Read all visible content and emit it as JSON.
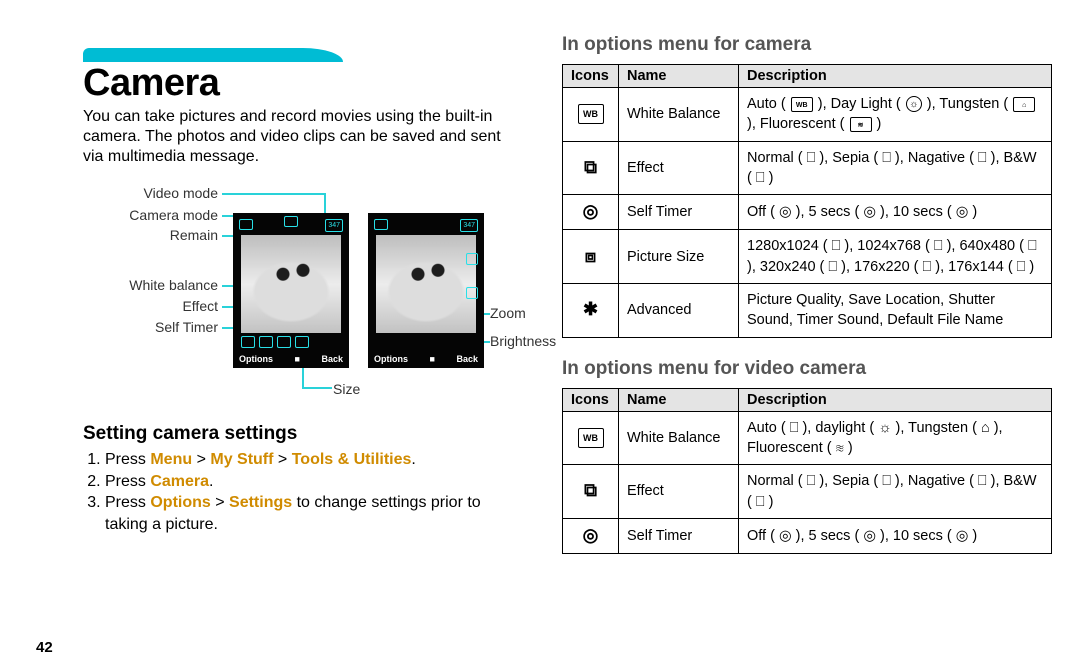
{
  "left": {
    "title": "Camera",
    "intro": "You can take pictures and record movies using the built-in camera. The photos and video clips can be saved and sent via multimedia message.",
    "labels": {
      "video_mode": "Video mode",
      "camera_mode": "Camera mode",
      "remain": "Remain",
      "white_balance": "White balance",
      "effect": "Effect",
      "self_timer": "Self Timer",
      "zoom": "Zoom",
      "brightness": "Brightness",
      "size": "Size"
    },
    "sc": {
      "counter": "347",
      "options": "Options",
      "back": "Back"
    },
    "settings_heading": "Setting camera settings",
    "steps": {
      "s1a": "Press ",
      "s1b": "Menu",
      "s1c": " > ",
      "s1d": "My Stuff",
      "s1e": " > ",
      "s1f": "Tools & Utilities",
      "s1g": ".",
      "s2a": "Press ",
      "s2b": "Camera",
      "s2c": ".",
      "s3a": "Press ",
      "s3b": "Options",
      "s3c": " > ",
      "s3d": "Settings",
      "s3e": " to change settings prior to taking a picture."
    }
  },
  "right": {
    "heading_camera": "In options menu for camera",
    "heading_video": "In options menu for video camera",
    "th_icons": "Icons",
    "th_name": "Name",
    "th_desc": "Description",
    "camera_rows": [
      {
        "name": "White Balance",
        "desc_pre": "Auto ( ",
        "desc_mid1": " ), Day Light ( ",
        "desc_mid2": " ), Tungsten ( ",
        "desc_mid3": " ), Fluorescent ( ",
        "desc_end": " )"
      },
      {
        "name": "Effect",
        "desc": "Normal ( ⎕ ), Sepia ( ⎕ ), Nagative ( ⎕ ), B&W ( ⎕ )"
      },
      {
        "name": "Self Timer",
        "desc": "Off ( ◎ ), 5 secs ( ◎ ), 10 secs ( ◎ )"
      },
      {
        "name": "Picture Size",
        "desc": "1280x1024 ( ⎕ ), 1024x768 ( ⎕ ), 640x480 ( ⎕ ),  320x240 ( ⎕ ), 176x220 ( ⎕ ), 176x144 ( ⎕ )"
      },
      {
        "name": "Advanced",
        "desc": "Picture Quality, Save Location, Shutter Sound, Timer Sound, Default File Name"
      }
    ],
    "video_rows": [
      {
        "name": "White Balance",
        "desc": "Auto ( ⎕ ), daylight ( ☼ ), Tungsten ( ⌂ ), Fluorescent ( ≋ )"
      },
      {
        "name": "Effect",
        "desc": "Normal ( ⎕ ), Sepia ( ⎕ ), Nagative ( ⎕ ), B&W ( ⎕ )"
      },
      {
        "name": "Self Timer",
        "desc": "Off ( ◎ ), 5 secs ( ◎ ), 10 secs ( ◎ )"
      }
    ]
  },
  "page_number": "42",
  "icons": {
    "wb": "WB",
    "effect": "⧉",
    "timer": "◎",
    "size": "⧈",
    "advanced": "✱"
  }
}
